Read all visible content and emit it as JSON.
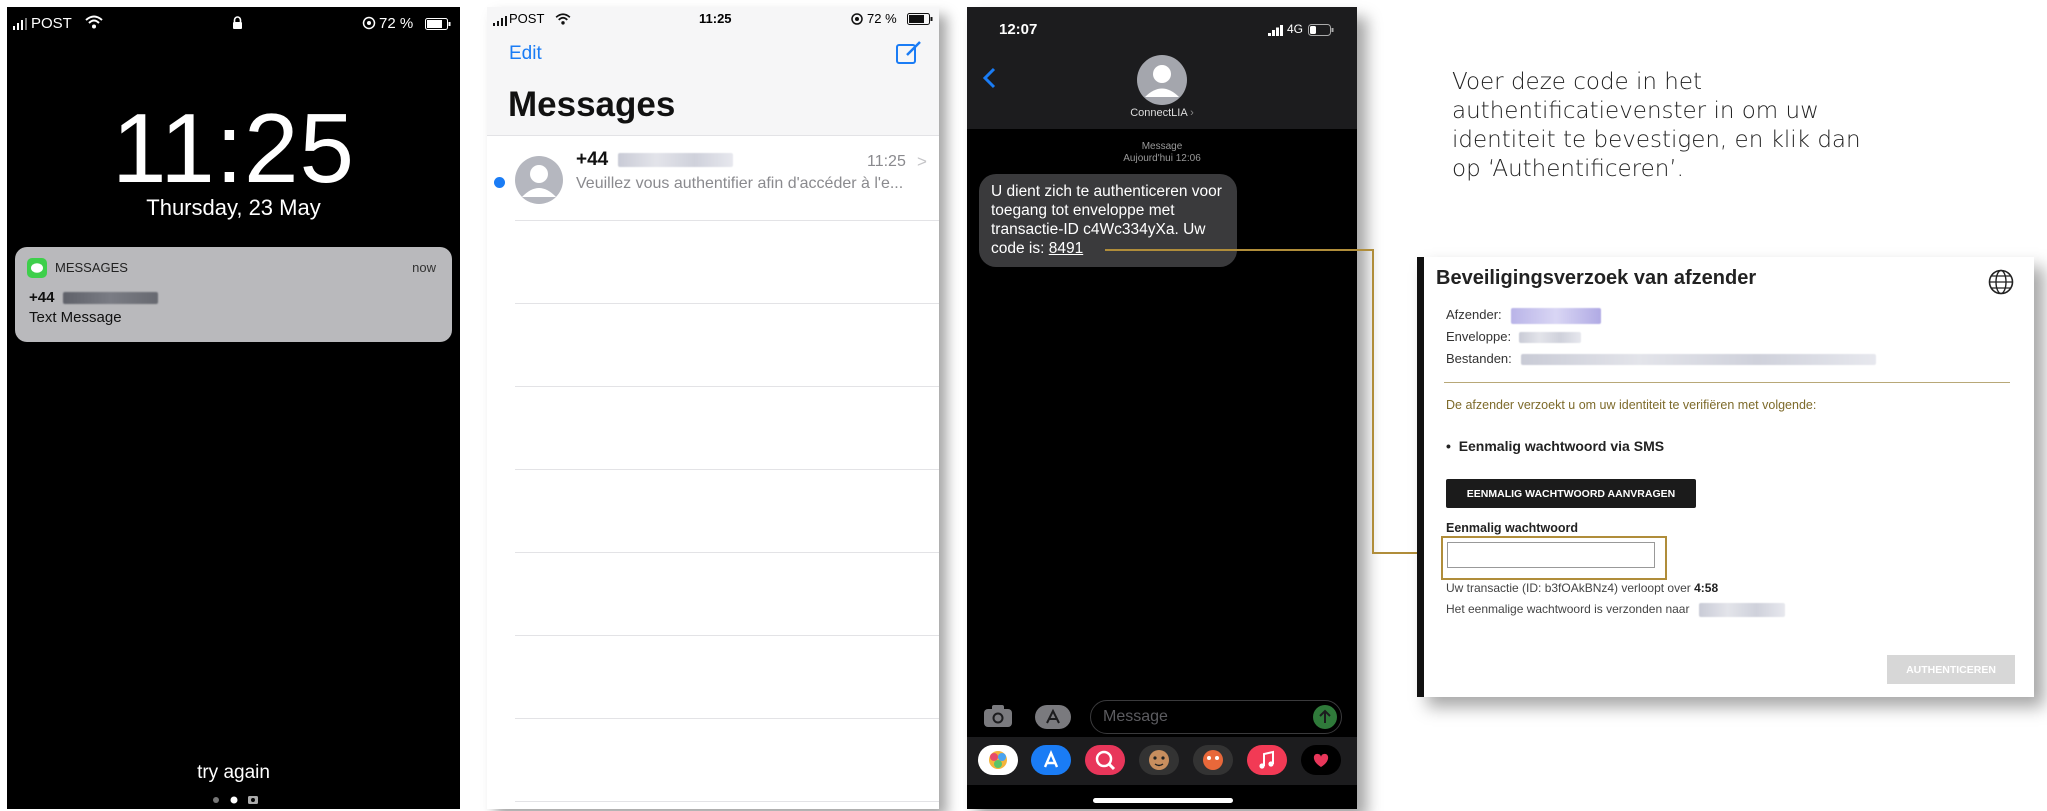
{
  "lock": {
    "carrier": "POST",
    "battery": "72 %",
    "time": "11:25",
    "date": "Thursday, 23 May",
    "notification": {
      "app": "MESSAGES",
      "when": "now",
      "sender_prefix": "+44",
      "body": "Text Message"
    },
    "try_again": "try again"
  },
  "messages_list": {
    "carrier": "POST",
    "time": "11:25",
    "battery": "72 %",
    "edit": "Edit",
    "title": "Messages",
    "item": {
      "sender_prefix": "+44",
      "time": "11:25",
      "preview": "Veuillez vous authentifier afin d'accéder à l'e..."
    }
  },
  "conversation": {
    "time": "12:07",
    "network": "4G",
    "contact": "ConnectLIA",
    "meta_line1": "Message",
    "meta_line2": "Aujourd'hui 12:06",
    "bubble_text": "U dient zich te authenticeren voor toegang tot enveloppe met transactie-ID c4Wc334yXa. Uw code is: ",
    "code": "8491",
    "input_placeholder": "Message"
  },
  "instruction": "Voer deze code in het authentificatievenster in om uw identiteit te bevestigen, en klik dan op ‘Authentificeren’.",
  "dialog": {
    "title": "Beveiligingsverzoek van afzender",
    "afzender_label": "Afzender:",
    "enveloppe_label": "Enveloppe:",
    "bestanden_label": "Bestanden:",
    "request_text": "De afzender verzoekt u om uw identiteit te verifiëren met volgende:",
    "bullet": "Eenmalig wachtwoord via SMS",
    "request_button": "EENMALIG WACHTWOORD AANVRAGEN",
    "field_label": "Eenmalig wachtwoord",
    "field_value": "",
    "expiry_prefix": "Uw transactie (ID: b3fOAkBNz4) verloopt over ",
    "expiry_time": "4:58",
    "sent_text": "Het eenmalige wachtwoord is verzonden naar",
    "auth_button": "AUTHENTICEREN"
  },
  "colors": {
    "accent_blue": "#1a7cf5",
    "olive": "#7d6a2a",
    "connector": "#b08d3a"
  }
}
